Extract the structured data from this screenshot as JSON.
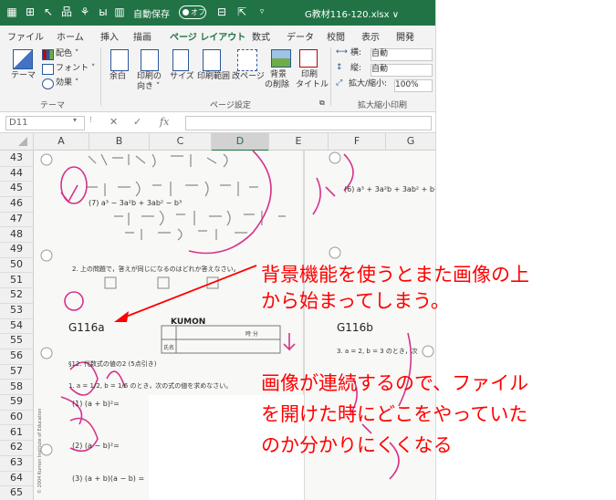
{
  "titlebar": {
    "autosave_label": "自動保存",
    "autosave_state": "オフ",
    "filename": "G教材116-120.xlsx ∨",
    "color": "#217346"
  },
  "menu": {
    "tabs": [
      "ファイル",
      "ホーム",
      "挿入",
      "描画",
      "ページ レイアウト",
      "数式",
      "データ",
      "校閲",
      "表示",
      "開発"
    ],
    "active": "ページ レイアウト"
  },
  "ribbon": {
    "theme": {
      "button": "テーマ",
      "colors": "配色 ˅",
      "fonts": "フォント ˅",
      "effects": "効果 ˅",
      "group": "テーマ"
    },
    "page_setup": {
      "margins": "余白",
      "orientation_1": "印刷の",
      "orientation_2": "向き ˅",
      "size": "サイズ",
      "print_area": "印刷範囲",
      "breaks": "改ページ",
      "background_1": "背景",
      "background_2": "の削除",
      "titles_1": "印刷",
      "titles_2": "タイトル",
      "group": "ページ設定"
    },
    "scale": {
      "width_label": "横:",
      "width_value": "自動",
      "height_label": "縦:",
      "height_value": "自動",
      "zoom_label": "拡大/縮小:",
      "zoom_value": "100%",
      "group": "拡大縮小印刷"
    }
  },
  "formula_bar": {
    "name_box": "D11",
    "fx": "fx"
  },
  "grid": {
    "columns": [
      "A",
      "B",
      "C",
      "D",
      "E",
      "F",
      "G"
    ],
    "selected_column": "D",
    "rows": [
      "43",
      "44",
      "45",
      "46",
      "47",
      "48",
      "49",
      "50",
      "51",
      "52",
      "53",
      "54",
      "55",
      "56",
      "57",
      "58",
      "59",
      "60",
      "61",
      "62",
      "63",
      "64",
      "65"
    ]
  },
  "worksheet": {
    "header_left": "G116a",
    "logo": "KUMON",
    "header_right": "G116b",
    "time_label": "時 分",
    "name_label": "氏名",
    "problem_no": "§12. 代数式の値の2 (5点引き)",
    "q1": "1. a = 1/2, b = 1/6 のとき，次の式の値を求めなさい。",
    "q2": "2. 上の問題で，答えが同じになるのはどれか答えなさい。",
    "q3_right": "3. a = 2, b = 3 のとき，次",
    "item_a2b2": "(1)  (a + b)²=",
    "item_ab2": "(2)  (a − b)²=",
    "item_3": "(3)  (a + b)(a − b) =",
    "item_6": "(6)  a³ + 3a²b + 3ab² + b³",
    "item_7": "(7)  a³ − 3a²b + 3ab² − b³",
    "copyright": "© 2004 Kumon Institute of Education"
  },
  "annotation": {
    "line1": "背景機能を使うとまた画像の上",
    "line2": "から始まってしまう。",
    "line3": "画像が連続するので、ファイル",
    "line4": "を開けた時にどこをやっていた",
    "line5": "のか分かりにくくなる",
    "color": "#ff0000"
  }
}
